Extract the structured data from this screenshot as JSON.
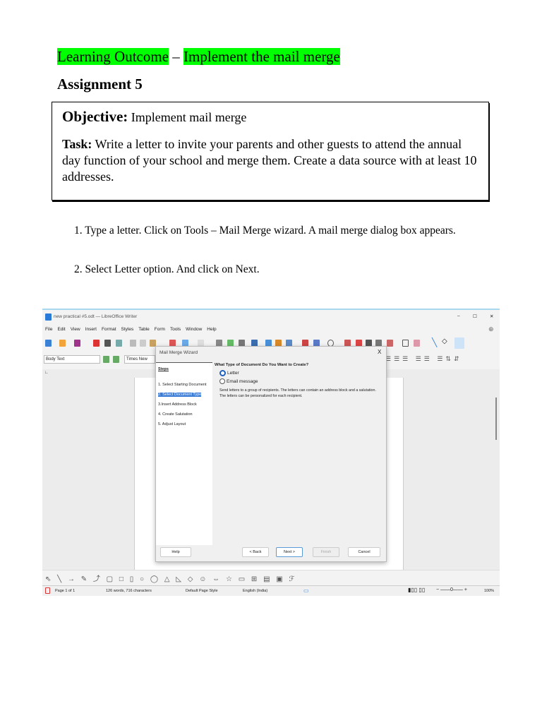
{
  "heading": {
    "learning_outcome": "Learning Outcome",
    "dash": " – ",
    "topic": "Implement the mail merge",
    "assignment": "Assignment 5"
  },
  "objective_box": {
    "objective_label": "Objective:",
    "objective_text": " Implement mail merge",
    "task_label": "Task:",
    "task_text": " Write a letter to invite your parents and other guests to attend the annual day function of  your school and merge them. Create a data source with at least 10 addresses."
  },
  "steps": [
    "1. Type a letter. Click on Tools – Mail Merge wizard. A mail merge dialog box appears.",
    "2. Select Letter option. And click on Next."
  ],
  "screenshot": {
    "window_title": "new practical #5.odt — LibreOffice Writer",
    "window_controls": [
      "–",
      "☐",
      "✕"
    ],
    "menu": [
      "File",
      "Edit",
      "View",
      "Insert",
      "Format",
      "Styles",
      "Table",
      "Form",
      "Tools",
      "Window",
      "Help"
    ],
    "paragraph_style": "Body Text",
    "font_name": "Times New Roman",
    "dialog": {
      "title": "Mail Merge Wizard",
      "close": "X",
      "steps_heading": "Steps",
      "steps": [
        "1. Select Starting Document",
        "2. Select Document Type",
        "3.Insert Address Block",
        "4. Create Salutation",
        "5. Adjust Layout"
      ],
      "active_step": 1,
      "question": "What Type of Document Do You Want to Create?",
      "options": [
        "Letter",
        "Email message"
      ],
      "selected_option": 0,
      "description": "Send letters to a group of recipients. The letters can contain an address block and a salutation. The letters can be personalized for each recipient.",
      "buttons": {
        "help": "Help",
        "back": "< Back",
        "next": "Next >",
        "finish": "Finish",
        "cancel": "Cancel"
      }
    },
    "status": {
      "page": "Page 1 of 1",
      "words": "126 words, 716 characters",
      "page_style": "Default Page Style",
      "language": "English (India)",
      "zoom": "100%"
    }
  }
}
